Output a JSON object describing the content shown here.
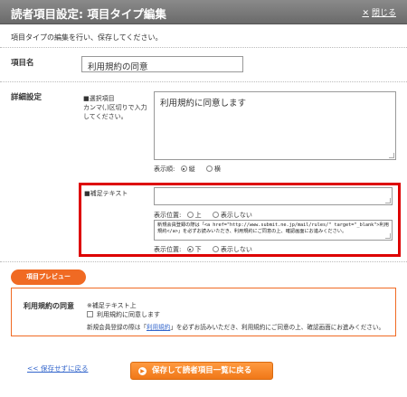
{
  "window": {
    "title": "読者項目設定: 項目タイプ編集",
    "close_label": "閉じる"
  },
  "description": "項目タイプの編集を行い、保存してください。",
  "item_name": {
    "label": "項目名",
    "value": "利用規約の同意"
  },
  "detail": {
    "label": "詳細設定",
    "choices": {
      "label": "■選択項目",
      "hint": "カンマ(,)区切りで入力してください。",
      "value": "利用規約に同意します",
      "display_order_label": "表示順:",
      "options": [
        "縦",
        "横"
      ],
      "selected": "縦"
    },
    "supplement": {
      "label": "■補足テキスト",
      "value_upper": "",
      "position_label_upper": "表示位置:",
      "upper_options": [
        "上",
        "表示しない"
      ],
      "value_lower": "新規会員登録の際は「<a href=\"http://www.submit.ne.jp/mail/rules/\" target=\"_blank\">利用規約</a>」を必ずお読みいただき、利用規約にご同意の上、確認画面にお進みください。",
      "position_label_lower": "表示位置:",
      "lower_options": [
        "下",
        "表示しない"
      ],
      "lower_selected": "下"
    }
  },
  "preview": {
    "tab_label": "項目プレビュー",
    "field_label": "利用規約の同意",
    "note_upper": "※補足テキスト上",
    "checkbox_label": "利用規約に同意します",
    "bottom_before": "新規会員登録の際は「",
    "bottom_link": "利用規約",
    "bottom_after": "」を必ずお読みいただき、利用規約にご同意の上、確認画面にお進みください。"
  },
  "footer": {
    "back_label": "<< 保存せずに戻る",
    "save_label": "保存して読者項目一覧に戻る"
  },
  "colors": {
    "accent": "#f06a23",
    "highlight": "#dd0000",
    "link": "#3366cc"
  }
}
